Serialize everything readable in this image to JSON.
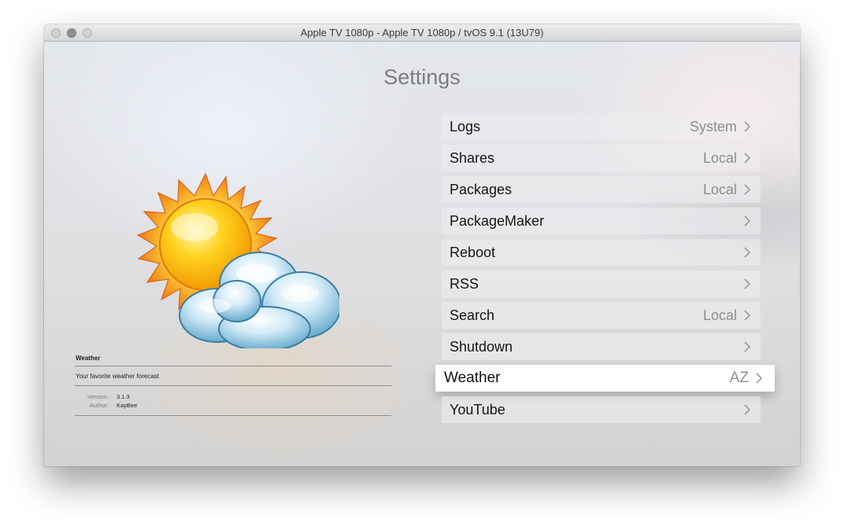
{
  "window": {
    "title": "Apple TV 1080p - Apple TV 1080p / tvOS 9.1 (13U79)"
  },
  "screen": {
    "heading": "Settings"
  },
  "plugin": {
    "name": "Weather",
    "description": "Your favorite weather forecast",
    "version_label": "Version:",
    "version": "3.1.3",
    "author_label": "Author:",
    "author": "KayBee",
    "icon": "sun-and-cloud-icon"
  },
  "menu": {
    "items": [
      {
        "label": "Logs",
        "value": "System"
      },
      {
        "label": "Shares",
        "value": "Local"
      },
      {
        "label": "Packages",
        "value": "Local"
      },
      {
        "label": "PackageMaker",
        "value": ""
      },
      {
        "label": "Reboot",
        "value": ""
      },
      {
        "label": "RSS",
        "value": ""
      },
      {
        "label": "Search",
        "value": "Local"
      },
      {
        "label": "Shutdown",
        "value": ""
      },
      {
        "label": "Weather",
        "value": "AZ",
        "focused": true
      },
      {
        "label": "YouTube",
        "value": ""
      }
    ]
  },
  "colors": {
    "sun": "#f5b800",
    "sun_rays": "#f08a1a",
    "cloud": "#8ec9e6",
    "focused_row": "#ffffff"
  }
}
